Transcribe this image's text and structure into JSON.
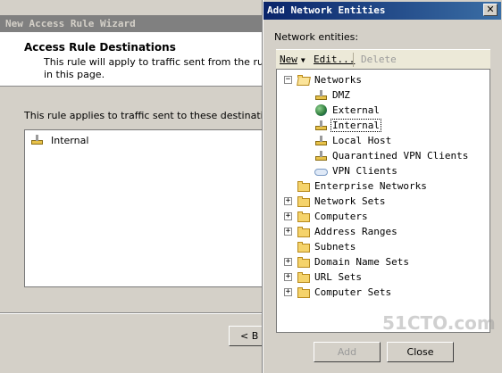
{
  "wizard": {
    "title": "New Access Rule Wizard",
    "heading": "Access Rule Destinations",
    "description_line1": "This rule will apply to traffic sent from the rule source",
    "description_line2": "in this page.",
    "body_label": "This rule applies to traffic sent to these destinations:",
    "destinations": [
      "Internal"
    ],
    "back_label": "< B"
  },
  "dialog": {
    "title": "Add Network Entities",
    "close_glyph": "✕",
    "section_label": "Network entities:",
    "toolbar": {
      "new_label": "New",
      "edit_label": "Edit...",
      "delete_label": "Delete"
    },
    "tree": {
      "root": "Networks",
      "children": [
        "DMZ",
        "External",
        "Internal",
        "Local Host",
        "Quarantined VPN Clients",
        "VPN Clients"
      ],
      "folders": [
        "Enterprise Networks",
        "Network Sets",
        "Computers",
        "Address Ranges",
        "Subnets",
        "Domain Name Sets",
        "URL Sets",
        "Computer Sets"
      ],
      "selected": "Internal"
    },
    "add_label": "Add",
    "close_label": "Close"
  },
  "watermark": "51CTO.com"
}
